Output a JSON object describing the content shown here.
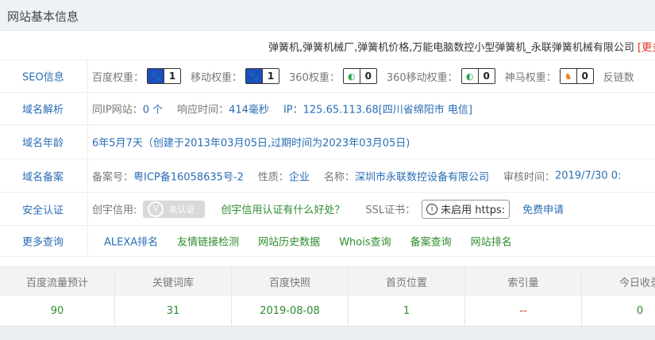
{
  "header": {
    "title": "网站基本信息"
  },
  "site_title": {
    "text": "弹簧机,弹簧机械厂,弹簧机价格,万能电脑数控小型弹簧机_永联弹簧机械有限公司",
    "more": "[更多"
  },
  "seo": {
    "label": "SEO信息",
    "baidu_label": "百度权重：",
    "baidu_value": "1",
    "mobile_label": "移动权重：",
    "mobile_value": "1",
    "s360_label": "360权重：",
    "s360_value": "0",
    "s360m_label": "360移动权重：",
    "s360m_value": "0",
    "shenma_label": "神马权重：",
    "shenma_value": "0",
    "backlinks_label": "反链数"
  },
  "dns": {
    "label": "域名解析",
    "same_ip_label": "同IP网站：",
    "same_ip_value": "0 个",
    "response_label": "响应时间：",
    "response_value": "414毫秒",
    "ip_label": "IP：",
    "ip_value": "125.65.113.68[四川省绵阳市 电信]"
  },
  "age": {
    "label": "域名年龄",
    "value": "6年5月7天（创建于2013年03月05日,过期时间为2023年03月05日)"
  },
  "beian": {
    "label": "域名备案",
    "no_label": "备案号：",
    "no_value": "粤ICP备16058635号-2",
    "nature_label": "性质：",
    "nature_value": "企业",
    "name_label": "名称：",
    "name_value": "深圳市永联数控设备有限公司",
    "audit_label": "审核时间：",
    "audit_value": "2019/7/30 0:"
  },
  "security": {
    "label": "安全认证",
    "credit_label": "创宇信用:",
    "cert_text": "未认证",
    "credit_link": "创宇信用认证有什么好处？",
    "ssl_label": "SSL证书：",
    "ssl_text": "未启用 https:",
    "apply_link": "免费申请"
  },
  "more": {
    "label": "更多查询",
    "links": [
      "ALEXA排名",
      "友情链接检测",
      "网站历史数据",
      "Whois查询",
      "备案查询",
      "网站排名"
    ]
  },
  "stats": {
    "headers": [
      "百度流量预计",
      "关键词库",
      "百度快照",
      "首页位置",
      "索引量",
      "今日收录"
    ],
    "values": [
      "90",
      "31",
      "2019-08-08",
      "1",
      "--",
      "0"
    ]
  },
  "colors": {
    "link": "#2a6db5",
    "green": "#2e8b2e",
    "red": "#e0301e"
  }
}
